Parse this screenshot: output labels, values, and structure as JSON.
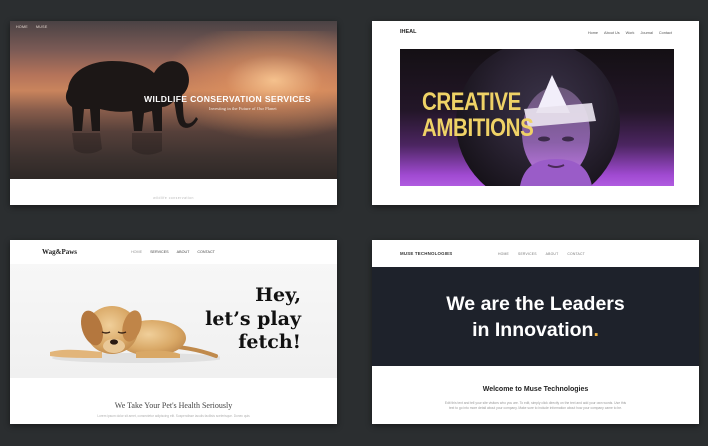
{
  "cards": [
    {
      "nav": [
        "HOME",
        "MUSE"
      ],
      "title": "WILDLIFE CONSERVATION SERVICES",
      "subtitle": "Investing in the Future of Our Planet",
      "footer": "wildlife conservation"
    },
    {
      "logo": "IHEAL",
      "nav": [
        "Home",
        "About Us",
        "Work",
        "Journal",
        "Contact"
      ],
      "hero_line1": "CREATIVE",
      "hero_line2": "AMBITIONS"
    },
    {
      "logo": "Wag&Paws",
      "nav": [
        "HOME",
        "SERVICES",
        "ABOUT",
        "CONTACT"
      ],
      "heading_line1": "Hey,",
      "heading_line2": "let’s play",
      "heading_line3": "fetch!",
      "section_title": "We Take Your Pet's Health Seriously",
      "section_text": "Lorem ipsum dolor sit amet, consectetur adipiscing elit. Suspendisse iaculis facilisis scelerisque. Donec quis"
    },
    {
      "logo": "MUSE TECHNOLOGIES",
      "nav": [
        "HOME",
        "SERVICES",
        "ABOUT",
        "CONTACT"
      ],
      "hero_line1": "We are the Leaders",
      "hero_line2": "in Innovation",
      "hero_dot": ".",
      "title": "Welcome to Muse Technologies",
      "text": "Edit this text and tell your site visitors who you are. To edit, simply click directly on the text and add your own words. Use this text to go into more detail about your company. Make sure to include information about how your company came to be."
    }
  ],
  "colors": {
    "page_bg": "#2b2e30",
    "creative_gold": "#efd266",
    "muse_dark": "#1e222b",
    "muse_accent": "#f2b544"
  }
}
